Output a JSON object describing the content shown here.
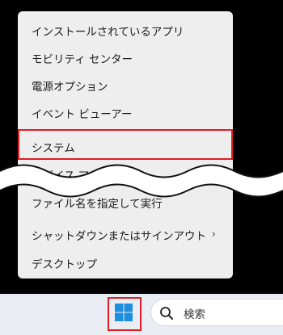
{
  "context_menu": {
    "items": [
      {
        "label": "インストールされているアプリ"
      },
      {
        "label": "モビリティ センター"
      },
      {
        "label": "電源オプション"
      },
      {
        "label": "イベント ビューアー"
      },
      {
        "label": "システム"
      },
      {
        "label": "デバイス マネージャー"
      },
      {
        "label": "ファイル名を指定して実行"
      },
      {
        "label": "シャットダウンまたはサインアウト",
        "submenu_icon": "chevron-right-icon"
      },
      {
        "label": "デスクトップ"
      }
    ],
    "chevron_glyph": "›",
    "highlighted_item": "システム"
  },
  "taskbar": {
    "start_icon": "windows-logo-icon",
    "search_icon": "search-icon",
    "search_label": "検索"
  },
  "colors": {
    "highlight": "#e11b22",
    "menu_background": "#eeeeee",
    "taskbar_background": "#eaeef4",
    "windows_logo": "#1e8fe0"
  }
}
